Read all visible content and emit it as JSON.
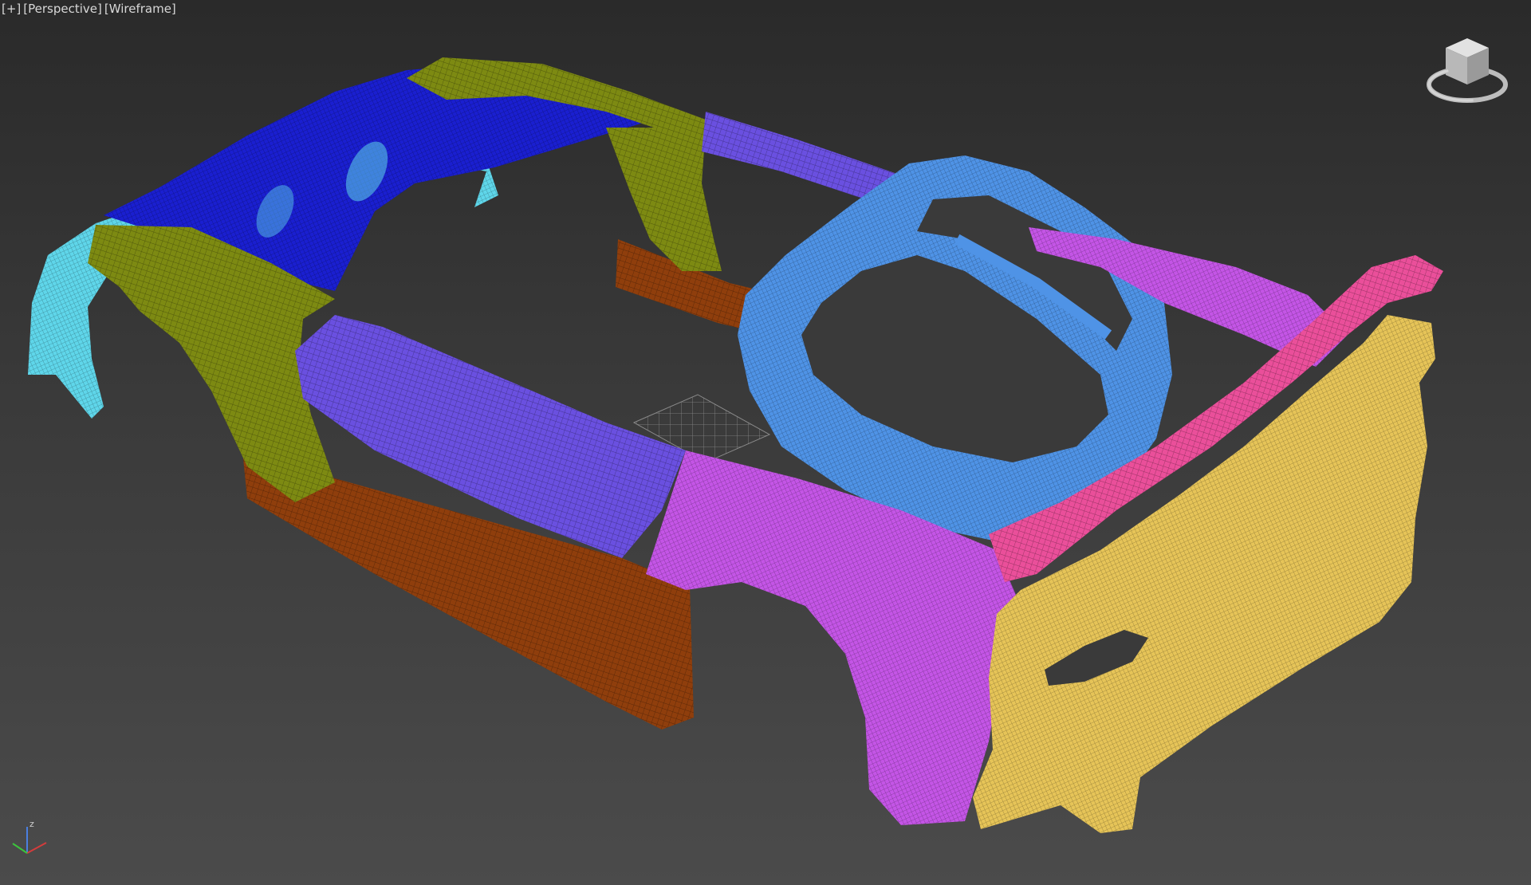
{
  "viewport": {
    "menu_label": "[+]",
    "view_label": "[Perspective]",
    "shading_label": "[Wireframe]"
  },
  "viewcube": {
    "icon": "viewcube-icon"
  },
  "axis_gizmo": {
    "z_label": "z",
    "icon": "axis-tripod-icon"
  },
  "colors": {
    "background_top": "#2a2a2a",
    "background_bottom": "#4b4b4b",
    "cyan": "#5fd6ea",
    "navy": "#1a1fd0",
    "olive": "#7d8a12",
    "violet": "#6a50e0",
    "orange": "#8f3e0c",
    "magenta": "#c455e6",
    "blue": "#4f93e6",
    "pink": "#ea4f9a",
    "yellow": "#e6c458"
  }
}
